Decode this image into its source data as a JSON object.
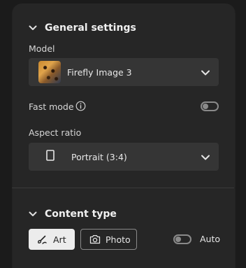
{
  "general": {
    "title": "General settings",
    "model_label": "Model",
    "model_value": "Firefly Image 3",
    "fast_mode_label": "Fast mode",
    "fast_mode_on": false,
    "aspect_label": "Aspect ratio",
    "aspect_value": "Portrait (3:4)"
  },
  "content_type": {
    "title": "Content type",
    "art_label": "Art",
    "photo_label": "Photo",
    "auto_label": "Auto",
    "selected": "Art",
    "auto_on": false
  },
  "icons": {
    "section_chevron": "chevron-up-icon",
    "dropdown_chevron": "chevron-down-icon",
    "info": "info-icon",
    "aspect": "portrait-rect-icon",
    "art": "brush-icon",
    "photo": "camera-icon"
  },
  "colors": {
    "panel": "#262626",
    "background": "#1b1b1b",
    "dropdown": "#353535",
    "selected_button": "#ececec"
  }
}
